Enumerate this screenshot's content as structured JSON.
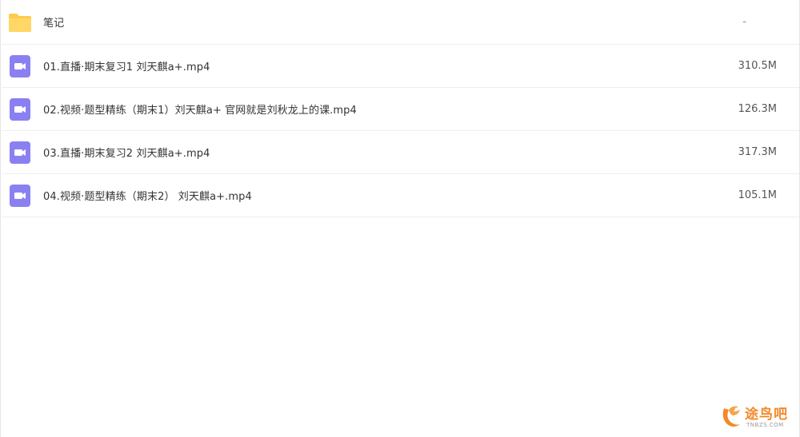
{
  "files": [
    {
      "type": "folder",
      "icon": "folder-icon",
      "name": "笔记",
      "size": "-"
    },
    {
      "type": "video",
      "icon": "video-file-icon",
      "name": "01.直播·期末复习1 刘天麒a+.mp4",
      "size": "310.5M"
    },
    {
      "type": "video",
      "icon": "video-file-icon",
      "name": "02.视频·题型精练（期末1）刘天麒a+ 官网就是刘秋龙上的课.mp4",
      "size": "126.3M"
    },
    {
      "type": "video",
      "icon": "video-file-icon",
      "name": "03.直播·期末复习2 刘天麒a+.mp4",
      "size": "317.3M"
    },
    {
      "type": "video",
      "icon": "video-file-icon",
      "name": "04.视频·题型精练（期末2） 刘天麒a+.mp4",
      "size": "105.1M"
    }
  ],
  "watermark": {
    "brand": "途鸟吧",
    "domain": "TNBZS.COM"
  },
  "colors": {
    "folder": "#FFCB4C",
    "video": "#8A80F2",
    "watermark": "#F18A2B"
  }
}
